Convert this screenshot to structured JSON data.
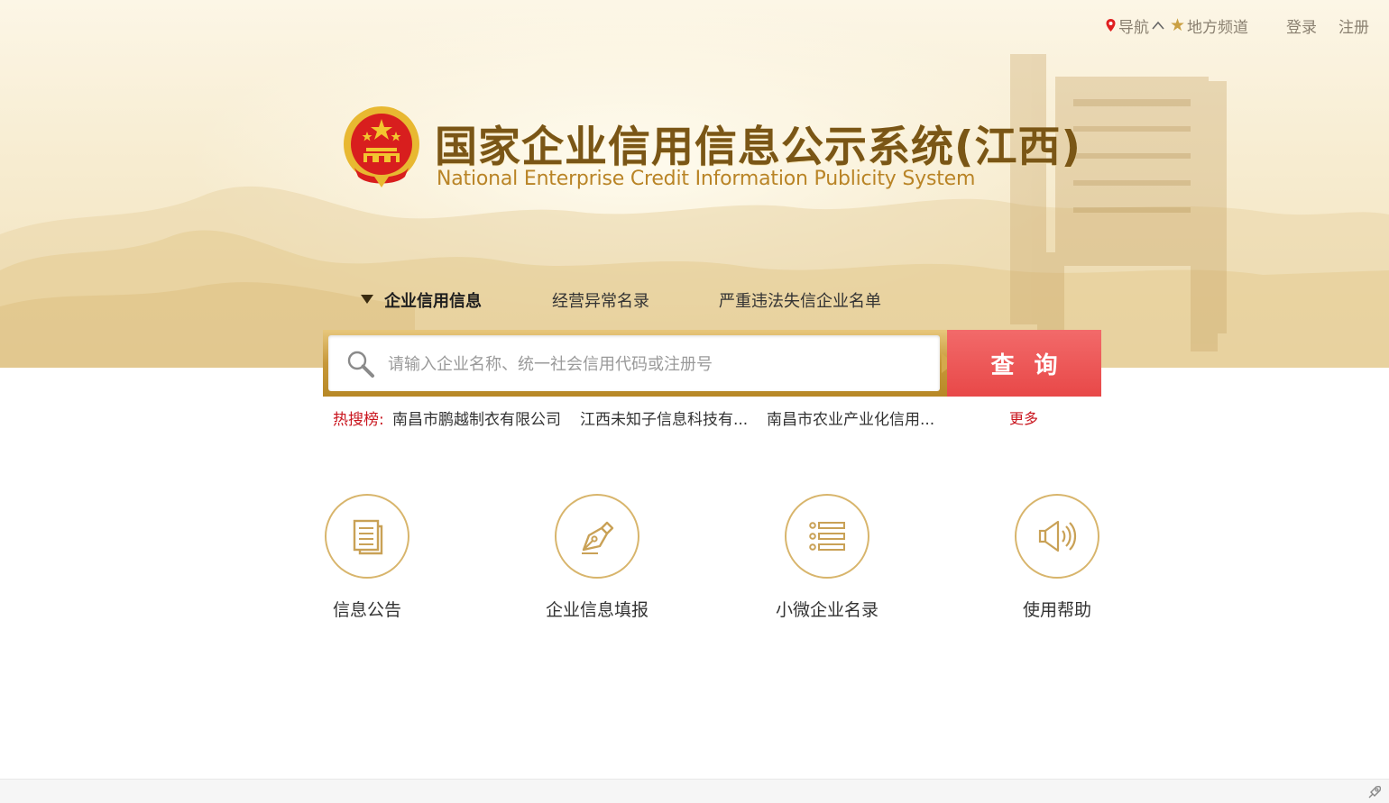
{
  "topnav": {
    "nav_label": "导航",
    "local_channel": "地方频道",
    "login": "登录",
    "register": "注册"
  },
  "header": {
    "title_cn": "国家企业信用信息公示系统(江西)",
    "title_en": "National Enterprise Credit Information Publicity System"
  },
  "tabs": [
    {
      "label": "企业信用信息",
      "active": true
    },
    {
      "label": "经营异常名录",
      "active": false
    },
    {
      "label": "严重违法失信企业名单",
      "active": false
    }
  ],
  "search": {
    "placeholder": "请输入企业名称、统一社会信用代码或注册号",
    "value": "",
    "button_label": "查询"
  },
  "hot_search": {
    "label": "热搜榜:",
    "items": [
      "南昌市鹏越制衣有限公司",
      "江西未知子信息科技有...",
      "南昌市农业产业化信用..."
    ],
    "more": "更多"
  },
  "quick_links": [
    {
      "label": "信息公告",
      "icon": "document-icon"
    },
    {
      "label": "企业信息填报",
      "icon": "pen-nib-icon"
    },
    {
      "label": "小微企业名录",
      "icon": "list-icon"
    },
    {
      "label": "使用帮助",
      "icon": "speaker-icon"
    }
  ],
  "colors": {
    "brand_gold": "#b98426",
    "title_brown": "#7a5616",
    "search_red": "#e84848",
    "hot_red": "#c9151e"
  }
}
